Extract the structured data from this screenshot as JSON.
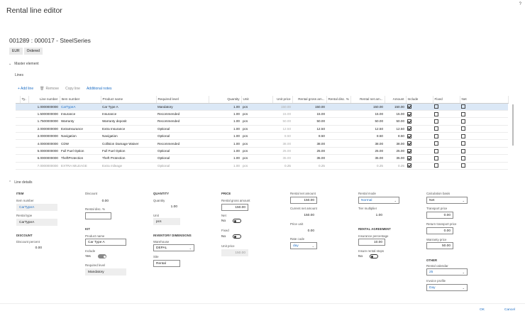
{
  "page": {
    "title": "Rental line editor",
    "help": "?",
    "record_id": "001289 : 000017 - SteelSeries",
    "chips": [
      "EUR",
      "Ordered"
    ],
    "master_section": "Master element",
    "lines_label": "Lines",
    "line_details_section": "Line details"
  },
  "toolbar": {
    "add": "+ Add line",
    "remove": "Remove",
    "copy": "Copy line",
    "notes": "Additional notes"
  },
  "grid": {
    "columns": [
      "",
      "Ty..",
      "Line number",
      "Item number",
      "Product name",
      "Required level",
      "Quantity",
      "Unit",
      "Unit price",
      "Rental gross am...",
      "Rental disc. %",
      "Rental net am...",
      "Amount",
      "Include",
      "Fixed",
      "Net"
    ],
    "rows": [
      {
        "line": "1.0000000000",
        "item": "CarTypeA",
        "product": "Car Type A",
        "level": "Mandatory",
        "qty": "1.00",
        "unit": "pcs",
        "price": "150.00",
        "gross": "150.00",
        "disc": "",
        "net": "150.00",
        "amount": "150.00",
        "include": true,
        "fixed": false,
        "netcb": false
      },
      {
        "line": "1.5000000000",
        "item": "Insurance",
        "product": "Insurance",
        "level": "Recommended",
        "qty": "1.00",
        "unit": "pcs",
        "price": "15.00",
        "gross": "15.00",
        "disc": "",
        "net": "15.00",
        "amount": "15.00",
        "include": true,
        "fixed": false,
        "netcb": false
      },
      {
        "line": "1.7500000000",
        "item": "Warranty",
        "product": "Warranty deposit",
        "level": "Recommended",
        "qty": "1.00",
        "unit": "pcs",
        "price": "50.00",
        "gross": "50.00",
        "disc": "",
        "net": "50.00",
        "amount": "50.00",
        "include": true,
        "fixed": false,
        "netcb": false
      },
      {
        "line": "2.0000000000",
        "item": "ExtraInsurance",
        "product": "Extra Insurance",
        "level": "Optional",
        "qty": "1.00",
        "unit": "pcs",
        "price": "12.50",
        "gross": "12.50",
        "disc": "",
        "net": "12.50",
        "amount": "12.50",
        "include": true,
        "fixed": false,
        "netcb": false
      },
      {
        "line": "3.0000000000",
        "item": "Navigation",
        "product": "Navigation",
        "level": "Optional",
        "qty": "1.00",
        "unit": "pcs",
        "price": "8.50",
        "gross": "8.50",
        "disc": "",
        "net": "8.50",
        "amount": "8.50",
        "include": true,
        "fixed": false,
        "netcb": false
      },
      {
        "line": "4.0000000000",
        "item": "CDW",
        "product": "Collision Damage Waiver",
        "level": "Recommended",
        "qty": "1.00",
        "unit": "pcs",
        "price": "38.00",
        "gross": "38.00",
        "disc": "",
        "net": "38.00",
        "amount": "38.00",
        "include": true,
        "fixed": false,
        "netcb": false
      },
      {
        "line": "5.0000000000",
        "item": "Full Fuel Option",
        "product": "Full Fuel Option",
        "level": "Optional",
        "qty": "1.00",
        "unit": "pcs",
        "price": "25.00",
        "gross": "25.00",
        "disc": "",
        "net": "25.00",
        "amount": "25.00",
        "include": true,
        "fixed": false,
        "netcb": false
      },
      {
        "line": "6.0000000000",
        "item": "TheftProtection",
        "product": "Theft Protection",
        "level": "Optional",
        "qty": "1.00",
        "unit": "pcs",
        "price": "35.00",
        "gross": "35.00",
        "disc": "",
        "net": "35.00",
        "amount": "35.00",
        "include": true,
        "fixed": false,
        "netcb": false
      },
      {
        "line": "7.0000000000",
        "item": "EXTRA MILEAGE",
        "product": "Extra mileage",
        "level": "Optional",
        "qty": "1.00",
        "unit": "pcs",
        "price": "0.25",
        "gross": "0.25",
        "disc": "",
        "net": "0.25",
        "amount": "0.25",
        "include": true,
        "fixed": false,
        "netcb": false
      }
    ]
  },
  "details": {
    "item_hdr": "ITEM",
    "item_number_lbl": "Item number",
    "item_number": "CarTypeA",
    "rental_type_lbl": "Rental type",
    "rental_type": "CarTypeA",
    "discount_hdr": "DISCOUNT",
    "discount_pct_lbl": "Discount percent",
    "discount_pct": "0.00",
    "discount_lbl": "Discount",
    "discount": "0.00",
    "rental_disc_lbl": "Rental disc. %",
    "rental_disc": "",
    "kit_hdr": "KIT",
    "product_name_lbl": "Product name",
    "product_name": "Car Type A",
    "include_lbl": "Include",
    "include_val": "Yes",
    "required_level_lbl": "Required level",
    "required_level": "Mandatory",
    "quantity_hdr": "QUANTITY",
    "quantity_lbl": "Quantity",
    "quantity": "1.00",
    "unit_lbl": "Unit",
    "unit": "pcs",
    "inv_hdr": "INVENTORY DIMENSIONS",
    "warehouse_lbl": "Warehouse",
    "warehouse": "DEPAL",
    "site_lbl": "Site",
    "site": "Rental",
    "price_hdr": "PRICE",
    "gross_lbl": "Rental gross amount",
    "gross": "150.00",
    "net_lbl": "Net",
    "net_val": "No",
    "fixed_lbl": "Fixed",
    "fixed_val": "No",
    "unit_price_lbl": "Unit price",
    "unit_price": "150.00",
    "net_amount_lbl": "Rental net amount",
    "net_amount": "150.00",
    "current_net_lbl": "Current net amount",
    "current_net": "150.00",
    "price_unit_lbl": "Price unit",
    "price_unit": "0.00",
    "rate_code_lbl": "Rate code",
    "rate_code": "day",
    "rental_mode_lbl": "Rental mode",
    "rental_mode": "Normal",
    "tier_lbl": "Tier multiplier",
    "tier": "1.00",
    "agreement_hdr": "RENTAL AGREEMENT",
    "ins_pct_lbl": "Insurance percentage",
    "ins_pct": "10.00",
    "ins_stops_lbl": "Insure rental stops",
    "ins_stops_val": "No",
    "calc_basis_lbl": "Calculation basis",
    "calc_basis": "Net",
    "transport_lbl": "Transport price",
    "transport": "0.00",
    "return_transport_lbl": "Return transport price",
    "return_transport": "0.00",
    "warranty_lbl": "Warranty price",
    "warranty": "50.00",
    "other_hdr": "OTHER",
    "calendar_lbl": "Rental calendar",
    "calendar": "25",
    "invoice_profile_lbl": "Invoice profile",
    "invoice_profile": "Day"
  },
  "footer": {
    "ok": "OK",
    "cancel": "Cancel"
  }
}
